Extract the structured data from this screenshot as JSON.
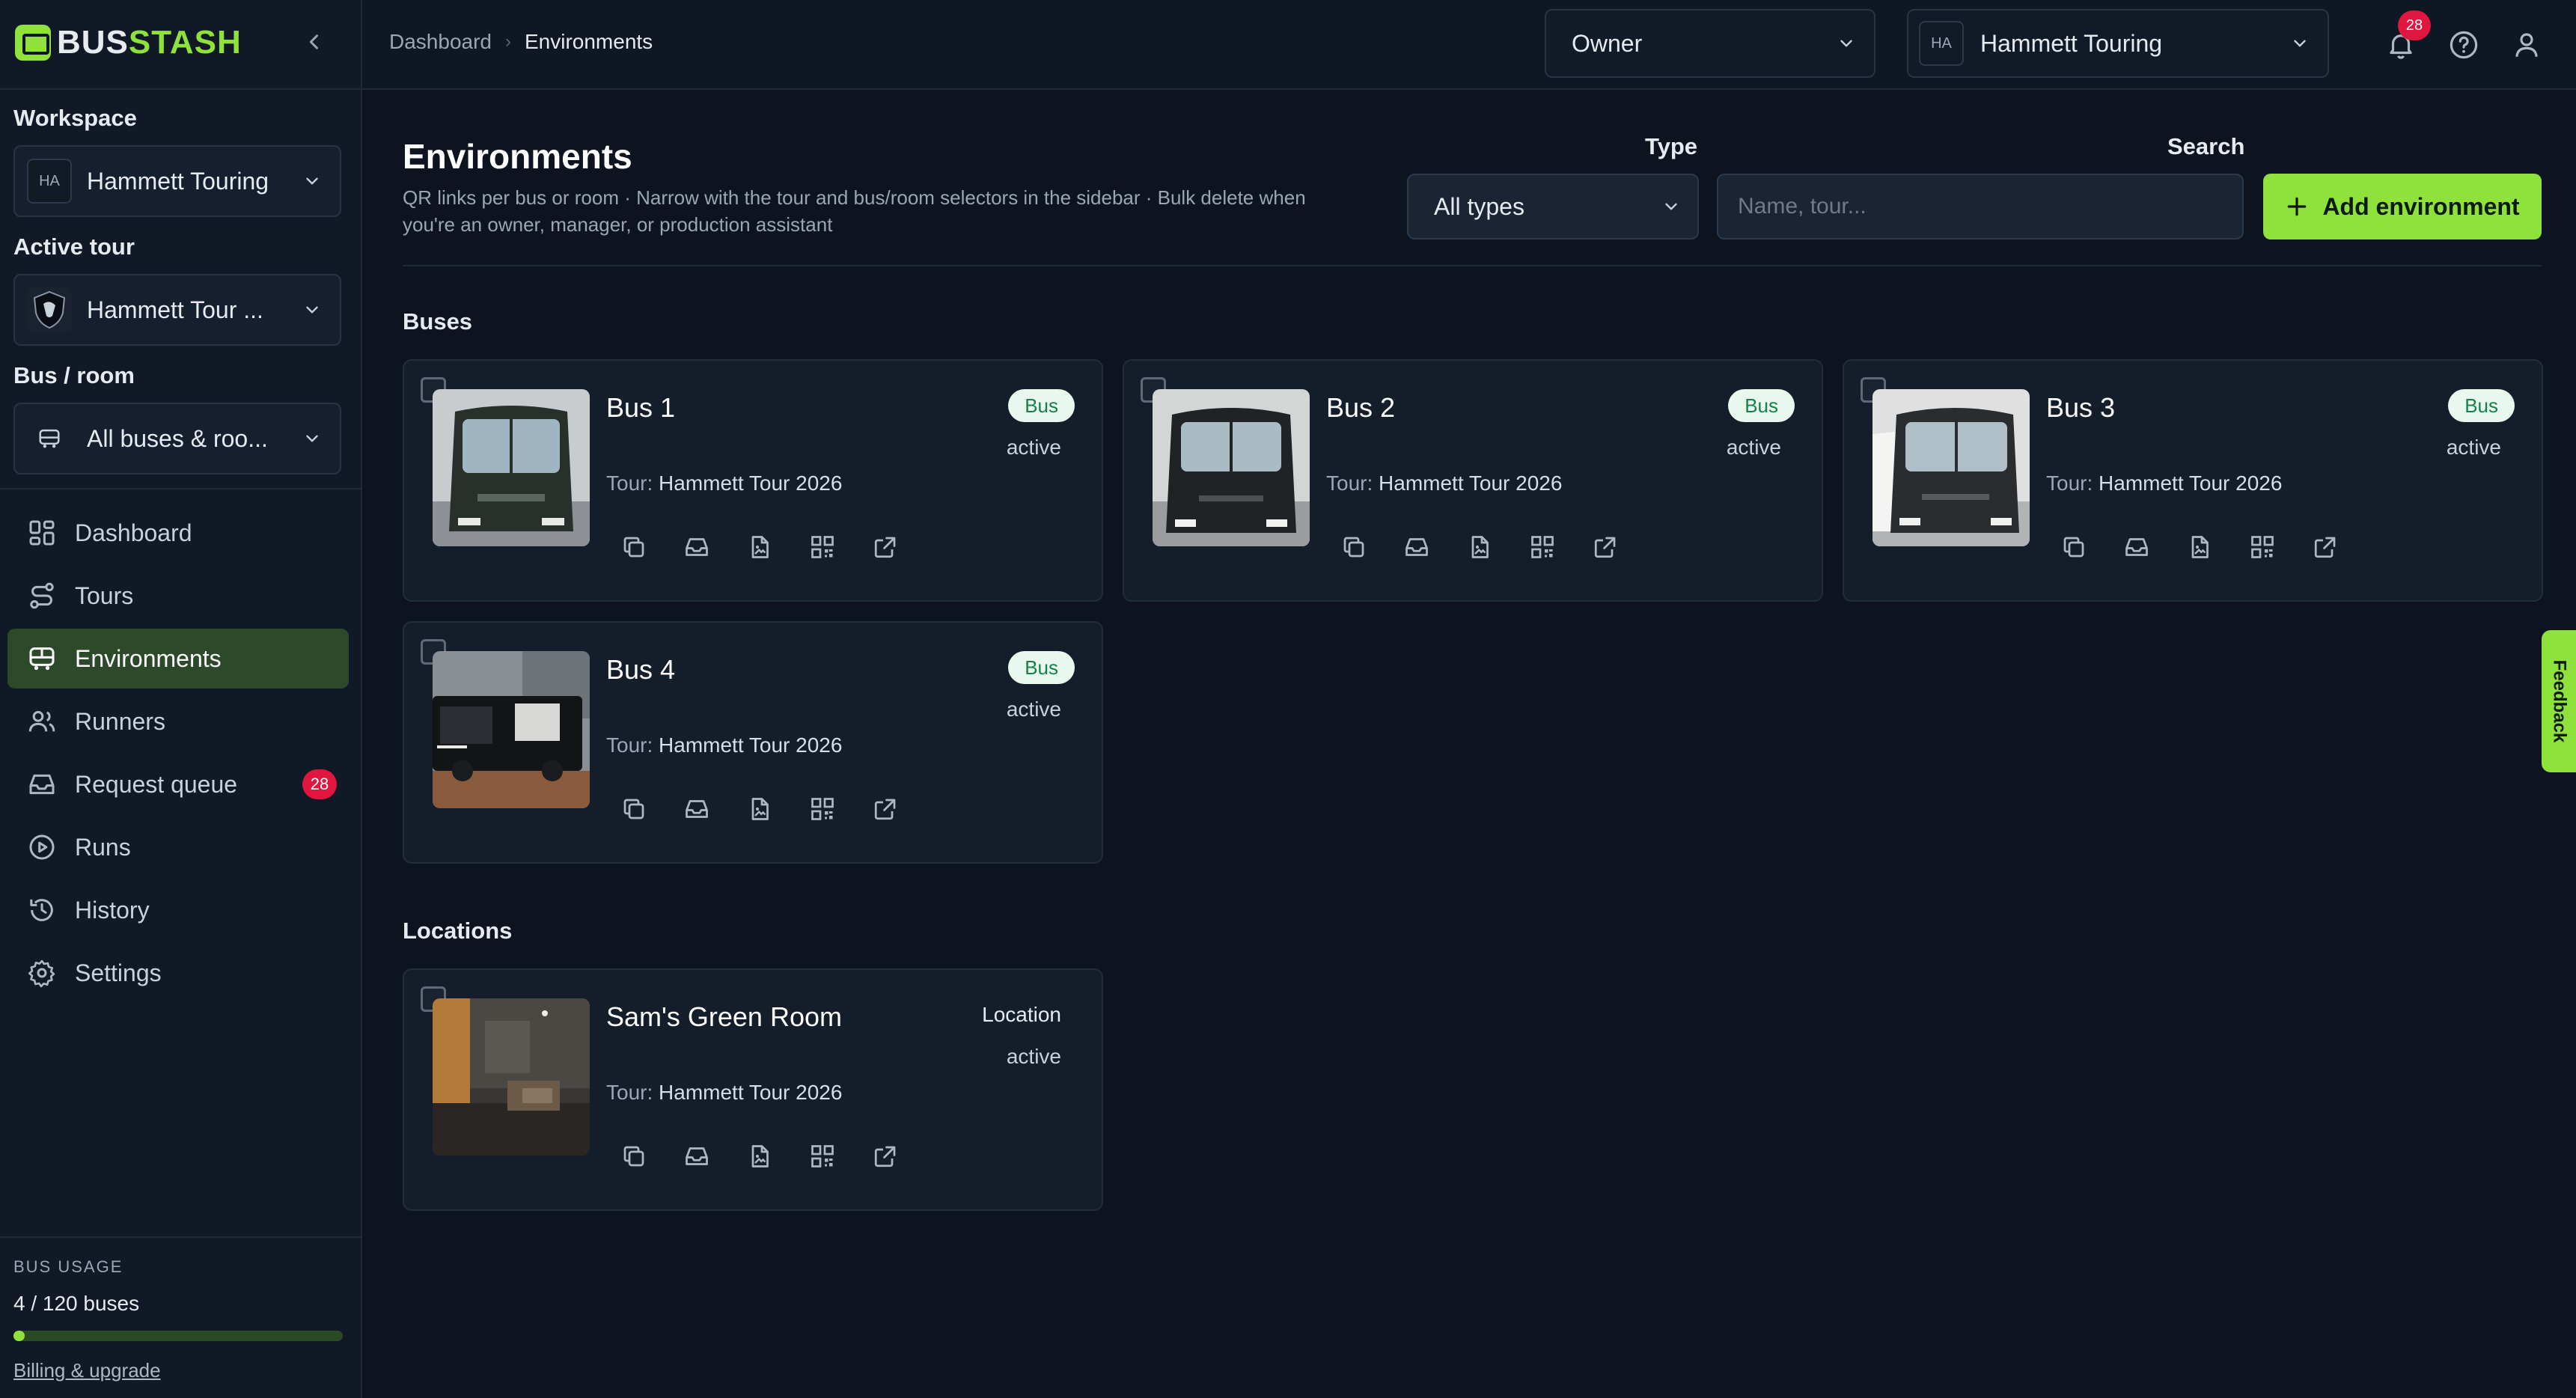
{
  "brand": {
    "name_part1": "BUS",
    "name_part2": "STASH",
    "accent_color": "#8fe13c"
  },
  "sidebar": {
    "workspace_label": "Workspace",
    "workspace_initials": "HA",
    "workspace_value": "Hammett Touring",
    "active_tour_label": "Active tour",
    "active_tour_value": "Hammett Tour ...",
    "bus_room_label": "Bus / room",
    "bus_room_value": "All buses & roo...",
    "nav": [
      {
        "label": "Dashboard",
        "icon": "dashboard-icon"
      },
      {
        "label": "Tours",
        "icon": "tours-icon"
      },
      {
        "label": "Environments",
        "icon": "bus-icon",
        "active": true
      },
      {
        "label": "Runners",
        "icon": "users-icon"
      },
      {
        "label": "Request queue",
        "icon": "inbox-icon",
        "count": "28"
      },
      {
        "label": "Runs",
        "icon": "play-circle-icon"
      },
      {
        "label": "History",
        "icon": "history-icon"
      },
      {
        "label": "Settings",
        "icon": "gear-icon"
      }
    ],
    "usage": {
      "title": "BUS USAGE",
      "count_text": "4 / 120 buses",
      "fraction": 0.0333,
      "link": "Billing & upgrade"
    }
  },
  "topbar": {
    "breadcrumb": [
      "Dashboard",
      "Environments"
    ],
    "role_value": "Owner",
    "workspace_initials": "HA",
    "workspace_value": "Hammett Touring",
    "notification_count": "28"
  },
  "main": {
    "title": "Environments",
    "description": "QR links per bus or room · Narrow with the tour and bus/room selectors in the sidebar · Bulk delete when you're an owner, manager, or production assistant",
    "type_label": "Type",
    "type_value": "All types",
    "search_label": "Search",
    "search_placeholder": "Name, tour...",
    "add_button": "Add environment",
    "buses_section": "Buses",
    "locations_section": "Locations",
    "tour_prefix": "Tour:",
    "buses": [
      {
        "name": "Bus 1",
        "type": "Bus",
        "status": "active",
        "tour": "Hammett Tour 2026"
      },
      {
        "name": "Bus 2",
        "type": "Bus",
        "status": "active",
        "tour": "Hammett Tour 2026"
      },
      {
        "name": "Bus 3",
        "type": "Bus",
        "status": "active",
        "tour": "Hammett Tour 2026"
      },
      {
        "name": "Bus 4",
        "type": "Bus",
        "status": "active",
        "tour": "Hammett Tour 2026"
      }
    ],
    "locations": [
      {
        "name": "Sam's Green Room",
        "type": "Location",
        "status": "active",
        "tour": "Hammett Tour 2026"
      }
    ],
    "card_actions": [
      "copy-icon",
      "inbox-icon",
      "document-image-icon",
      "qr-code-icon",
      "external-link-icon"
    ]
  },
  "feedback_tab": "Feedback"
}
